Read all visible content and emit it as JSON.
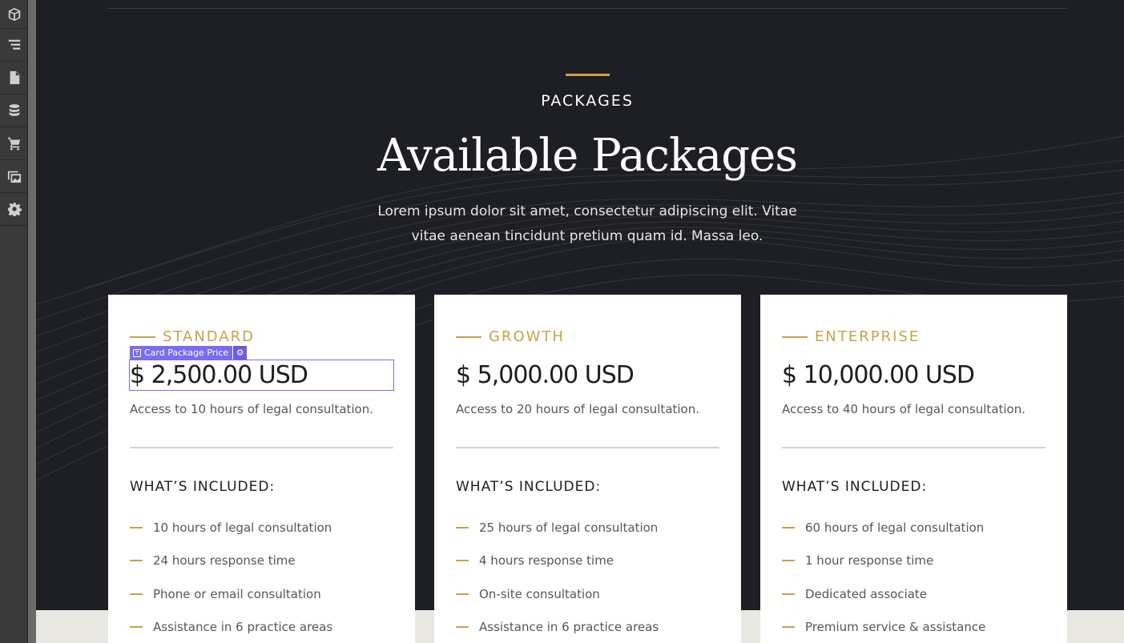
{
  "toolbar": {
    "tools": [
      {
        "icon": "cube-icon"
      },
      {
        "icon": "navigator-icon"
      },
      {
        "icon": "pages-icon"
      },
      {
        "icon": "cms-database-icon"
      },
      {
        "icon": "ecommerce-cart-icon"
      },
      {
        "icon": "assets-icon"
      },
      {
        "icon": "settings-gear-icon"
      }
    ]
  },
  "section": {
    "eyebrow": "PACKAGES",
    "title": "Available Packages",
    "lead": "Lorem ipsum dolor sit amet, consectetur adipiscing elit. Vitae vitae aenean tincidunt pretium quam id. Massa leo."
  },
  "selection_tag": {
    "label": "Card Package Price"
  },
  "colors": {
    "accent": "#c9a14a",
    "dark_bg": "#1e1f24",
    "selection": "#7a6cf0"
  },
  "cards": [
    {
      "tier": "STANDARD",
      "price": "$ 2,500.00 USD",
      "description": "Access to 10 hours of legal consultation.",
      "included_heading": "WHAT’S INCLUDED:",
      "features": [
        "10 hours of legal consultation",
        "24 hours response time",
        "Phone or email consultation",
        "Assistance in 6 practice areas"
      ]
    },
    {
      "tier": "GROWTH",
      "price": "$ 5,000.00 USD",
      "description": "Access to 20 hours of legal consultation.",
      "included_heading": "WHAT’S INCLUDED:",
      "features": [
        "25 hours of legal consultation",
        "4 hours response time",
        "On-site consultation",
        "Assistance in 6 practice areas"
      ]
    },
    {
      "tier": "ENTERPRISE",
      "price": "$ 10,000.00 USD",
      "description": "Access to 40 hours of legal consultation.",
      "included_heading": "WHAT’S INCLUDED:",
      "features": [
        "60 hours of legal consultation",
        "1 hour response time",
        "Dedicated associate",
        "Premium service & assistance"
      ]
    }
  ]
}
